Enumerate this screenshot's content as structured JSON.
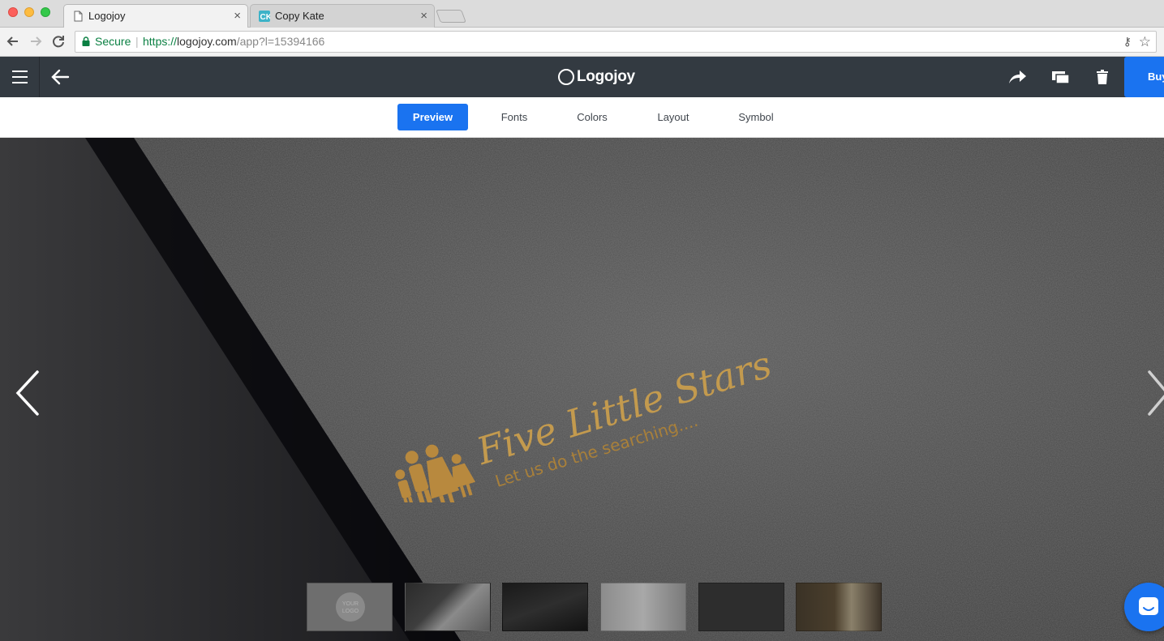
{
  "browser": {
    "tabs": [
      {
        "title": "Logojoy",
        "active": true
      },
      {
        "title": "Copy Kate",
        "active": false
      }
    ],
    "address": {
      "secure_label": "Secure",
      "url_scheme": "https://",
      "url_host": "logojoy.com",
      "url_path": "/app?l=15394166"
    }
  },
  "app": {
    "brand": "Logojoy",
    "buy_label": "Buy",
    "accent": "#1a73f0",
    "header_bg": "#333a41"
  },
  "subnav": {
    "tabs": [
      "Preview",
      "Fonts",
      "Colors",
      "Layout",
      "Symbol"
    ],
    "active": "Preview"
  },
  "preview": {
    "logo_title": "Five Little Stars",
    "logo_tagline": "Let us do the searching....",
    "logo_color": "#b8893e",
    "thumbnail_text": "YOUR LOGO"
  }
}
